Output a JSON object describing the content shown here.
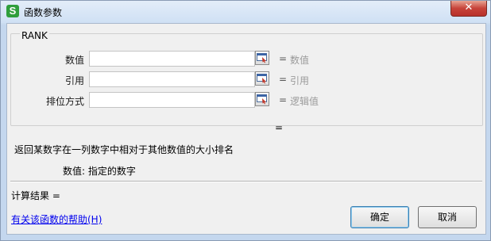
{
  "window": {
    "title": "函数参数",
    "app_icon_letter": "S",
    "close_glyph": "✕"
  },
  "function": {
    "name": "RANK",
    "args": [
      {
        "label": "数值",
        "value": "",
        "equals": "=",
        "hint": "数值"
      },
      {
        "label": "引用",
        "value": "",
        "equals": "=",
        "hint": "引用"
      },
      {
        "label": "排位方式",
        "value": "",
        "equals": "=",
        "hint": "逻辑值"
      }
    ],
    "result_equals": "=",
    "description": "返回某数字在一列数字中相对于其他数值的大小排名",
    "param_description": "数值:  指定的数字"
  },
  "footer": {
    "calc_result": "计算结果  =",
    "help_link": "有关该函数的帮助(H)",
    "ok_label": "确定",
    "cancel_label": "取消"
  },
  "icons": {
    "app": "spreadsheet-app-icon",
    "close": "close-icon",
    "ref_picker": "range-select-icon"
  },
  "colors": {
    "title_bar": "#cfe0f4",
    "close_button": "#c7433a",
    "link": "#0000ee",
    "hint_text": "#9a9a9a",
    "ok_border": "#3c7fb1"
  }
}
